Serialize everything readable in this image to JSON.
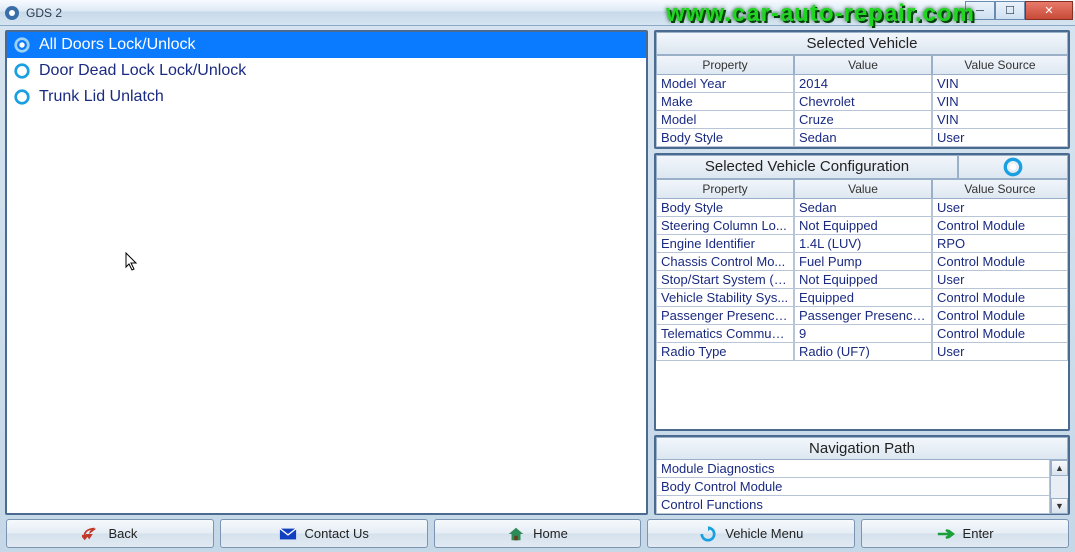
{
  "window": {
    "title": "GDS 2"
  },
  "watermark": "www.car-auto-repair.com",
  "functions": [
    {
      "label": "All Doors Lock/Unlock",
      "selected": true
    },
    {
      "label": "Door Dead Lock Lock/Unlock",
      "selected": false
    },
    {
      "label": "Trunk Lid Unlatch",
      "selected": false
    }
  ],
  "vehicle": {
    "title": "Selected Vehicle",
    "columns": [
      "Property",
      "Value",
      "Value Source"
    ],
    "rows": [
      {
        "property": "Model Year",
        "value": "2014",
        "source": "VIN"
      },
      {
        "property": "Make",
        "value": "Chevrolet",
        "source": "VIN"
      },
      {
        "property": "Model",
        "value": "Cruze",
        "source": "VIN"
      },
      {
        "property": "Body Style",
        "value": "Sedan",
        "source": "User"
      }
    ]
  },
  "config": {
    "title": "Selected Vehicle Configuration",
    "columns": [
      "Property",
      "Value",
      "Value Source"
    ],
    "rows": [
      {
        "property": "Body Style",
        "value": "Sedan",
        "source": "User"
      },
      {
        "property": "Steering Column Lo...",
        "value": "Not Equipped",
        "source": "Control Module"
      },
      {
        "property": "Engine Identifier",
        "value": "1.4L (LUV)",
        "source": "RPO"
      },
      {
        "property": "Chassis Control Mo...",
        "value": "Fuel Pump",
        "source": "Control Module"
      },
      {
        "property": "Stop/Start System (K...",
        "value": "Not Equipped",
        "source": "User"
      },
      {
        "property": "Vehicle Stability Sys...",
        "value": "Equipped",
        "source": "Control Module"
      },
      {
        "property": "Passenger Presence...",
        "value": "Passenger Presence...",
        "source": "Control Module"
      },
      {
        "property": "Telematics Commun...",
        "value": "9",
        "source": "Control Module"
      },
      {
        "property": "Radio Type",
        "value": "Radio (UF7)",
        "source": "User"
      }
    ]
  },
  "nav": {
    "title": "Navigation Path",
    "items": [
      "Module Diagnostics",
      "Body Control Module",
      "Control Functions"
    ]
  },
  "footer": {
    "back": "Back",
    "contact": "Contact Us",
    "home": "Home",
    "menu": "Vehicle Menu",
    "enter": "Enter"
  }
}
